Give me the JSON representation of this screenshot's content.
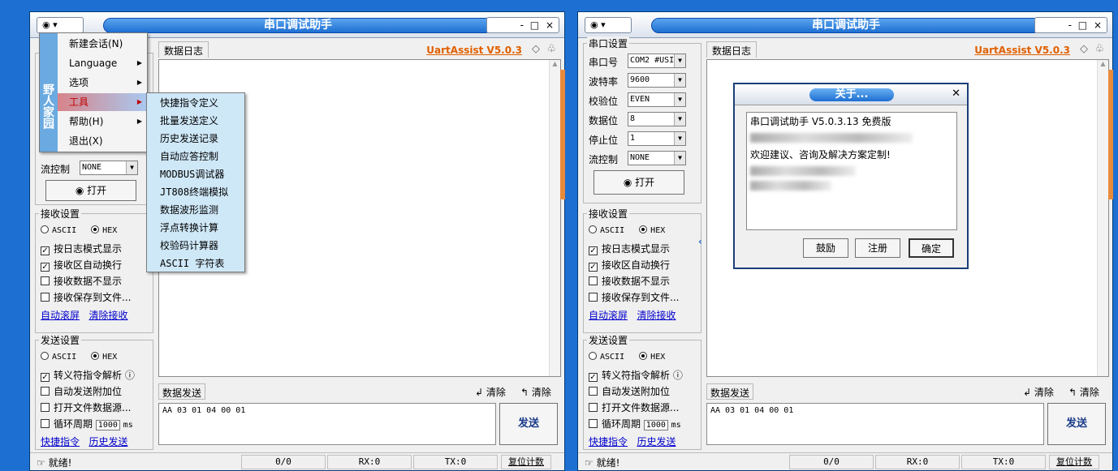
{
  "app": {
    "title": "串口调试助手",
    "brand": "UartAssist V5.0.3",
    "system_menu_glyph": "▾",
    "controls": "- □ ×",
    "pin_glyph": "⊣"
  },
  "tabs": {
    "log": "数据日志",
    "send": "数据发送"
  },
  "serial": {
    "group": "串口设置",
    "port_label": "串口号",
    "port_value": "COM2 #USI",
    "baud_label": "波特率",
    "baud_value": "9600",
    "parity_label": "校验位",
    "parity_value": "EVEN",
    "databits_label": "数据位",
    "databits_value": "8",
    "stopbits_label": "停止位",
    "stopbits_value": "1",
    "flow_label": "流控制",
    "flow_value": "NONE",
    "open_button": "打开"
  },
  "receive": {
    "group": "接收设置",
    "ascii": "ASCII",
    "hex": "HEX",
    "opt_log_mode": "按日志模式显示",
    "opt_autowrap": "接收区自动换行",
    "opt_no_display": "接收数据不显示",
    "opt_save_file": "接收保存到文件...",
    "link_autoscroll": "自动滚屏",
    "link_clear": "清除接收"
  },
  "send": {
    "group": "发送设置",
    "ascii": "ASCII",
    "hex": "HEX",
    "opt_escape": "转义符指令解析",
    "opt_append": "自动发送附加位",
    "opt_open_file": "打开文件数据源...",
    "opt_cycle": "循环周期",
    "cycle_value": "1000",
    "cycle_unit": "ms",
    "link_shortcut": "快捷指令",
    "link_history": "历史发送",
    "content": "AA 03 01 04 00 01",
    "clear1": "清除",
    "clear2": "清除",
    "send_button": "发送"
  },
  "status": {
    "ready": "就绪!",
    "count": "0/0",
    "rx": "RX:0",
    "tx": "TX:0",
    "reset": "复位计数"
  },
  "main_menu": {
    "strip": "野人家园",
    "items": [
      "新建会话(N)",
      "Language",
      "选项",
      "工具",
      "帮助(H)",
      "退出(X)"
    ]
  },
  "tools_submenu": [
    "快捷指令定义",
    "批量发送定义",
    "历史发送记录",
    "自动应答控制",
    "MODBUS调试器",
    "JT808终端模拟",
    "数据波形监测",
    "浮点转换计算",
    "校验码计算器",
    "ASCII 字符表"
  ],
  "about": {
    "title": "关于...",
    "version_line": "串口调试助手 V5.0.3.13 免费版",
    "welcome_line": "欢迎建议、咨询及解决方案定制!",
    "buttons": {
      "donate": "鼓励",
      "register": "注册",
      "ok": "确定"
    }
  }
}
